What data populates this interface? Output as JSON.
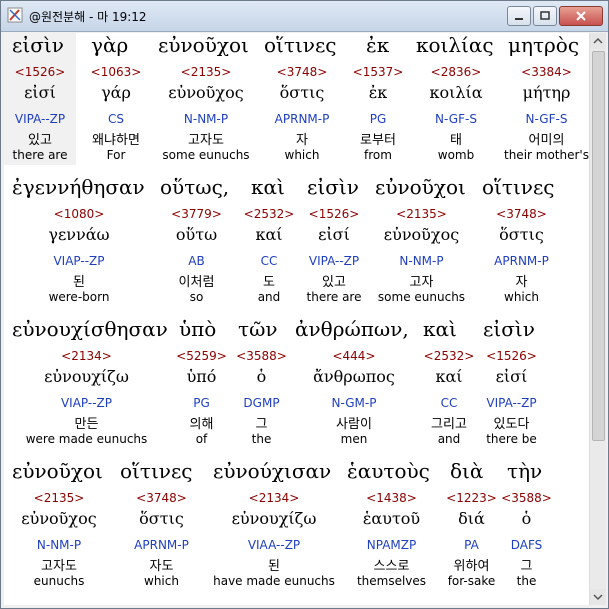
{
  "window": {
    "title": "@원전분해 - 마 19:12"
  },
  "rows": [
    {
      "words": [
        {
          "greek": "εἰσὶν",
          "strong": "<1526>",
          "lemma": "εἰσί",
          "parse": "VIPA--ZP",
          "korean": "있고",
          "english": "there are"
        },
        {
          "greek": "γὰρ",
          "strong": "<1063>",
          "lemma": "γάρ",
          "parse": "CS",
          "korean": "왜냐하면",
          "english": "For"
        },
        {
          "greek": "εὐνοῦχοι",
          "strong": "<2135>",
          "lemma": "εὐνοῦχος",
          "parse": "N-NM-P",
          "korean": "고자도",
          "english": "some eunuchs"
        },
        {
          "greek": "οἵτινες",
          "strong": "<3748>",
          "lemma": "ὅστις",
          "parse": "APRNM-P",
          "korean": "자",
          "english": "which"
        },
        {
          "greek": "ἐκ",
          "strong": "<1537>",
          "lemma": "ἐκ",
          "parse": "PG",
          "korean": "로부터",
          "english": "from"
        },
        {
          "greek": "κοιλίας",
          "strong": "<2836>",
          "lemma": "κοιλία",
          "parse": "N-GF-S",
          "korean": "태",
          "english": "womb"
        },
        {
          "greek": "μητρὸς",
          "strong": "<3384>",
          "lemma": "μήτηρ",
          "parse": "N-GF-S",
          "korean": "어미의",
          "english": "their mother's"
        }
      ]
    },
    {
      "words": [
        {
          "greek": "ἐγεννήθησαν",
          "strong": "<1080>",
          "lemma": "γεννάω",
          "parse": "VIAP--ZP",
          "korean": "된",
          "english": "were-born"
        },
        {
          "greek": "οὕτως,",
          "strong": "<3779>",
          "lemma": "οὕτω",
          "parse": "AB",
          "korean": "이처럼",
          "english": "so"
        },
        {
          "greek": "καὶ",
          "strong": "<2532>",
          "lemma": "καί",
          "parse": "CC",
          "korean": "도",
          "english": "and"
        },
        {
          "greek": "εἰσὶν",
          "strong": "<1526>",
          "lemma": "εἰσί",
          "parse": "VIPA--ZP",
          "korean": "있고",
          "english": "there are"
        },
        {
          "greek": "εὐνοῦχοι",
          "strong": "<2135>",
          "lemma": "εὐνοῦχος",
          "parse": "N-NM-P",
          "korean": "고자",
          "english": "some eunuchs"
        },
        {
          "greek": "οἵτινες",
          "strong": "<3748>",
          "lemma": "ὅστις",
          "parse": "APRNM-P",
          "korean": "자",
          "english": "which"
        }
      ]
    },
    {
      "words": [
        {
          "greek": "εὐνουχίσθησαν",
          "strong": "<2134>",
          "lemma": "εὐνουχίζω",
          "parse": "VIAP--ZP",
          "korean": "만든",
          "english": "were made eunuchs"
        },
        {
          "greek": "ὑπὸ",
          "strong": "<5259>",
          "lemma": "ὑπό",
          "parse": "PG",
          "korean": "의해",
          "english": "of"
        },
        {
          "greek": "τῶν",
          "strong": "<3588>",
          "lemma": "ὁ",
          "parse": "DGMP",
          "korean": "그",
          "english": "the"
        },
        {
          "greek": "ἀνθρώπων,",
          "strong": "<444>",
          "lemma": "ἄνθρωπος",
          "parse": "N-GM-P",
          "korean": "사람이",
          "english": "men"
        },
        {
          "greek": "καὶ",
          "strong": "<2532>",
          "lemma": "καί",
          "parse": "CC",
          "korean": "그리고",
          "english": "and"
        },
        {
          "greek": "εἰσὶν",
          "strong": "<1526>",
          "lemma": "εἰσί",
          "parse": "VIPA--ZP",
          "korean": "있도다",
          "english": "there be"
        }
      ]
    },
    {
      "words": [
        {
          "greek": "εὐνοῦχοι",
          "strong": "<2135>",
          "lemma": "εὐνοῦχος",
          "parse": "N-NM-P",
          "korean": "고자도",
          "english": "eunuchs"
        },
        {
          "greek": "οἵτινες",
          "strong": "<3748>",
          "lemma": "ὅστις",
          "parse": "APRNM-P",
          "korean": "자도",
          "english": "which"
        },
        {
          "greek": "εὐνούχισαν",
          "strong": "<2134>",
          "lemma": "εὐνουχίζω",
          "parse": "VIAA--ZP",
          "korean": "된",
          "english": "have made eunuchs"
        },
        {
          "greek": "ἑαυτοὺς",
          "strong": "<1438>",
          "lemma": "ἑαυτοῦ",
          "parse": "NPAMZP",
          "korean": "스스로",
          "english": "themselves"
        },
        {
          "greek": "διὰ",
          "strong": "<1223>",
          "lemma": "διά",
          "parse": "PA",
          "korean": "위하여",
          "english": "for-sake"
        },
        {
          "greek": "τὴν",
          "strong": "<3588>",
          "lemma": "ὁ",
          "parse": "DAFS",
          "korean": "그",
          "english": "the"
        }
      ]
    }
  ]
}
